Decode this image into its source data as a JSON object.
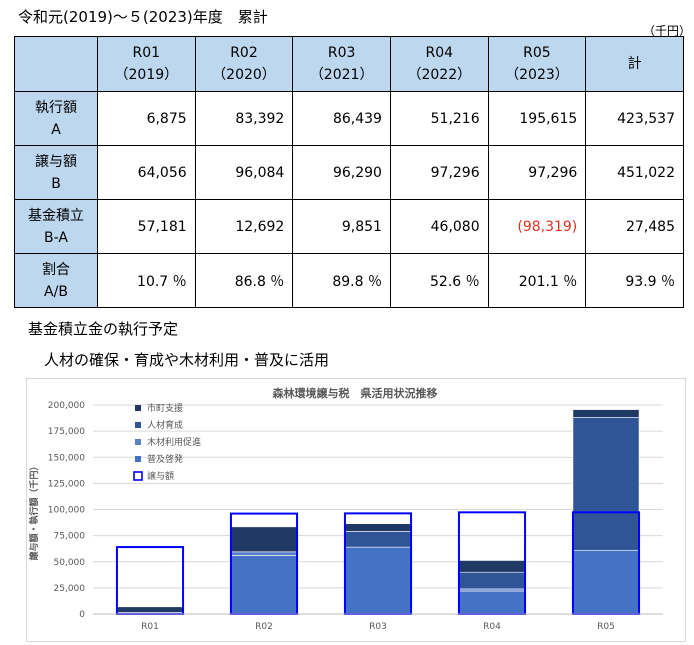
{
  "page": {
    "title": "令和元(2019)～５(2023)年度　累計",
    "unit": "（千円）",
    "subtitle1": "基金積立金の執行予定",
    "subtitle2": "人材の確保・育成や木材利用・普及に活用"
  },
  "table": {
    "columns": [
      {
        "line1": "R01",
        "line2": "（2019）"
      },
      {
        "line1": "R02",
        "line2": "（2020）"
      },
      {
        "line1": "R03",
        "line2": "（2021）"
      },
      {
        "line1": "R04",
        "line2": "（2022）"
      },
      {
        "line1": "R05",
        "line2": "（2023）"
      },
      {
        "line1": "計",
        "line2": ""
      }
    ],
    "rows": [
      {
        "label1": "執行額",
        "label2": "A",
        "values": [
          "6,875",
          "83,392",
          "86,439",
          "51,216",
          "195,615",
          "423,537"
        ],
        "negative": []
      },
      {
        "label1": "譲与額",
        "label2": "B",
        "values": [
          "64,056",
          "96,084",
          "96,290",
          "97,296",
          "97,296",
          "451,022"
        ],
        "negative": []
      },
      {
        "label1": "基金積立",
        "label2": "B-A",
        "values": [
          "57,181",
          "12,692",
          "9,851",
          "46,080",
          "(98,319)",
          "27,485"
        ],
        "negative": [
          4
        ]
      },
      {
        "label1": "割合",
        "label2": "A/B",
        "values": [
          "10.7 ％",
          "86.8 ％",
          "89.8 ％",
          "52.6 ％",
          "201.1 ％",
          "93.9 ％"
        ],
        "negative": []
      }
    ]
  },
  "chart_data": {
    "type": "bar",
    "title": "森林環境譲与税　県活用状況推移",
    "ylabel": "譲与額・執行額（千円）",
    "xlabel": "",
    "categories": [
      "R01",
      "R02",
      "R03",
      "R04",
      "R05"
    ],
    "ylim": [
      0,
      200000
    ],
    "yticks": [
      0,
      25000,
      50000,
      75000,
      100000,
      125000,
      150000,
      175000,
      200000
    ],
    "ytick_labels": [
      "0",
      "25,000",
      "50,000",
      "75,000",
      "100,000",
      "125,000",
      "150,000",
      "175,000",
      "200,000"
    ],
    "stacked": true,
    "series": [
      {
        "name": "普及啓発",
        "color": "#4472c4",
        "values": [
          0,
          56000,
          64000,
          22000,
          61000
        ]
      },
      {
        "name": "木材利用促進",
        "color": "#5b7fc9",
        "values": [
          0,
          3500,
          0,
          2000,
          0
        ]
      },
      {
        "name": "人材育成",
        "color": "#2f5597",
        "values": [
          1500,
          0,
          15000,
          16000,
          127000
        ]
      },
      {
        "name": "市町支援",
        "color": "#203864",
        "values": [
          5375,
          23892,
          7439,
          11216,
          7615
        ]
      }
    ],
    "outline_series": {
      "name": "譲与額",
      "color": "#0000ff",
      "values": [
        64056,
        96084,
        96290,
        97296,
        97296
      ]
    },
    "legend_order": [
      "市町支援",
      "人材育成",
      "木材利用促進",
      "普及啓発",
      "譲与額"
    ],
    "legend_position": "top-left",
    "grid": true
  }
}
